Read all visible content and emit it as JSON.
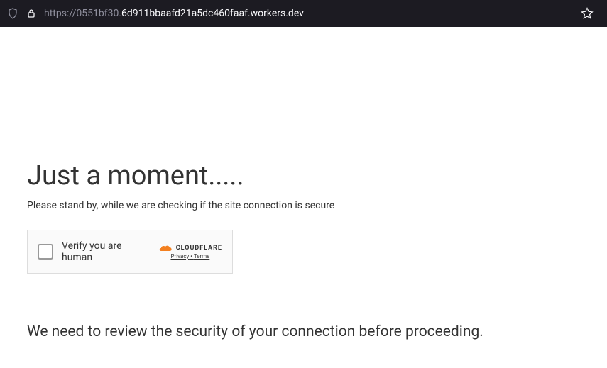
{
  "address_bar": {
    "url_dim_prefix": "https://0551bf30.",
    "url_highlighted": "6d911bbaafd21a5dc460faaf.workers.dev"
  },
  "page": {
    "title": "Just a moment.....",
    "subtitle": "Please stand by, while we are checking if the site connection is secure",
    "message": "We need to review the security of your connection before proceeding."
  },
  "captcha": {
    "label": "Verify you are human",
    "brand": "CLOUDFLARE",
    "privacy": "Privacy",
    "separator": " • ",
    "terms": "Terms"
  }
}
